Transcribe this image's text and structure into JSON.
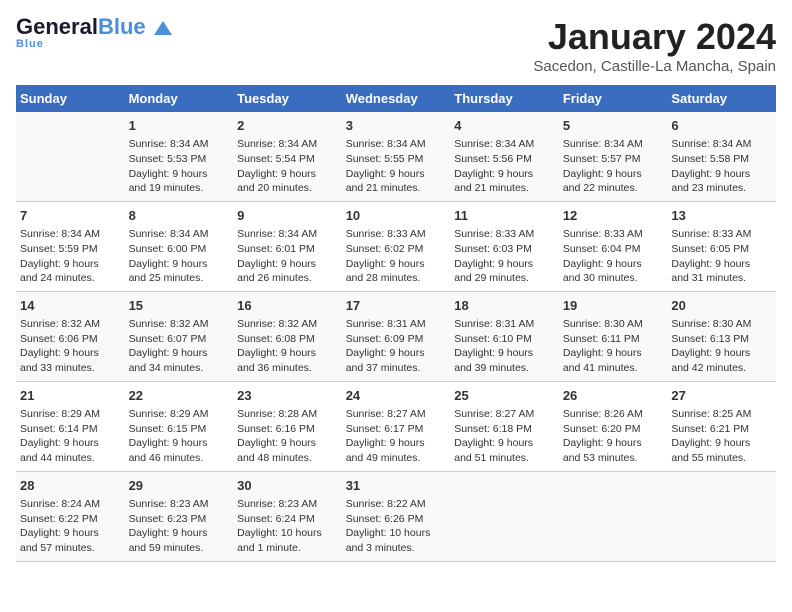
{
  "header": {
    "logo_general": "General",
    "logo_blue": "Blue",
    "logo_tagline": "Blue",
    "title": "January 2024",
    "subtitle": "Sacedon, Castille-La Mancha, Spain"
  },
  "weekdays": [
    "Sunday",
    "Monday",
    "Tuesday",
    "Wednesday",
    "Thursday",
    "Friday",
    "Saturday"
  ],
  "weeks": [
    [
      {
        "day": "",
        "info": ""
      },
      {
        "day": "1",
        "info": "Sunrise: 8:34 AM\nSunset: 5:53 PM\nDaylight: 9 hours\nand 19 minutes."
      },
      {
        "day": "2",
        "info": "Sunrise: 8:34 AM\nSunset: 5:54 PM\nDaylight: 9 hours\nand 20 minutes."
      },
      {
        "day": "3",
        "info": "Sunrise: 8:34 AM\nSunset: 5:55 PM\nDaylight: 9 hours\nand 21 minutes."
      },
      {
        "day": "4",
        "info": "Sunrise: 8:34 AM\nSunset: 5:56 PM\nDaylight: 9 hours\nand 21 minutes."
      },
      {
        "day": "5",
        "info": "Sunrise: 8:34 AM\nSunset: 5:57 PM\nDaylight: 9 hours\nand 22 minutes."
      },
      {
        "day": "6",
        "info": "Sunrise: 8:34 AM\nSunset: 5:58 PM\nDaylight: 9 hours\nand 23 minutes."
      }
    ],
    [
      {
        "day": "7",
        "info": "Sunrise: 8:34 AM\nSunset: 5:59 PM\nDaylight: 9 hours\nand 24 minutes."
      },
      {
        "day": "8",
        "info": "Sunrise: 8:34 AM\nSunset: 6:00 PM\nDaylight: 9 hours\nand 25 minutes."
      },
      {
        "day": "9",
        "info": "Sunrise: 8:34 AM\nSunset: 6:01 PM\nDaylight: 9 hours\nand 26 minutes."
      },
      {
        "day": "10",
        "info": "Sunrise: 8:33 AM\nSunset: 6:02 PM\nDaylight: 9 hours\nand 28 minutes."
      },
      {
        "day": "11",
        "info": "Sunrise: 8:33 AM\nSunset: 6:03 PM\nDaylight: 9 hours\nand 29 minutes."
      },
      {
        "day": "12",
        "info": "Sunrise: 8:33 AM\nSunset: 6:04 PM\nDaylight: 9 hours\nand 30 minutes."
      },
      {
        "day": "13",
        "info": "Sunrise: 8:33 AM\nSunset: 6:05 PM\nDaylight: 9 hours\nand 31 minutes."
      }
    ],
    [
      {
        "day": "14",
        "info": "Sunrise: 8:32 AM\nSunset: 6:06 PM\nDaylight: 9 hours\nand 33 minutes."
      },
      {
        "day": "15",
        "info": "Sunrise: 8:32 AM\nSunset: 6:07 PM\nDaylight: 9 hours\nand 34 minutes."
      },
      {
        "day": "16",
        "info": "Sunrise: 8:32 AM\nSunset: 6:08 PM\nDaylight: 9 hours\nand 36 minutes."
      },
      {
        "day": "17",
        "info": "Sunrise: 8:31 AM\nSunset: 6:09 PM\nDaylight: 9 hours\nand 37 minutes."
      },
      {
        "day": "18",
        "info": "Sunrise: 8:31 AM\nSunset: 6:10 PM\nDaylight: 9 hours\nand 39 minutes."
      },
      {
        "day": "19",
        "info": "Sunrise: 8:30 AM\nSunset: 6:11 PM\nDaylight: 9 hours\nand 41 minutes."
      },
      {
        "day": "20",
        "info": "Sunrise: 8:30 AM\nSunset: 6:13 PM\nDaylight: 9 hours\nand 42 minutes."
      }
    ],
    [
      {
        "day": "21",
        "info": "Sunrise: 8:29 AM\nSunset: 6:14 PM\nDaylight: 9 hours\nand 44 minutes."
      },
      {
        "day": "22",
        "info": "Sunrise: 8:29 AM\nSunset: 6:15 PM\nDaylight: 9 hours\nand 46 minutes."
      },
      {
        "day": "23",
        "info": "Sunrise: 8:28 AM\nSunset: 6:16 PM\nDaylight: 9 hours\nand 48 minutes."
      },
      {
        "day": "24",
        "info": "Sunrise: 8:27 AM\nSunset: 6:17 PM\nDaylight: 9 hours\nand 49 minutes."
      },
      {
        "day": "25",
        "info": "Sunrise: 8:27 AM\nSunset: 6:18 PM\nDaylight: 9 hours\nand 51 minutes."
      },
      {
        "day": "26",
        "info": "Sunrise: 8:26 AM\nSunset: 6:20 PM\nDaylight: 9 hours\nand 53 minutes."
      },
      {
        "day": "27",
        "info": "Sunrise: 8:25 AM\nSunset: 6:21 PM\nDaylight: 9 hours\nand 55 minutes."
      }
    ],
    [
      {
        "day": "28",
        "info": "Sunrise: 8:24 AM\nSunset: 6:22 PM\nDaylight: 9 hours\nand 57 minutes."
      },
      {
        "day": "29",
        "info": "Sunrise: 8:23 AM\nSunset: 6:23 PM\nDaylight: 9 hours\nand 59 minutes."
      },
      {
        "day": "30",
        "info": "Sunrise: 8:23 AM\nSunset: 6:24 PM\nDaylight: 10 hours\nand 1 minute."
      },
      {
        "day": "31",
        "info": "Sunrise: 8:22 AM\nSunset: 6:26 PM\nDaylight: 10 hours\nand 3 minutes."
      },
      {
        "day": "",
        "info": ""
      },
      {
        "day": "",
        "info": ""
      },
      {
        "day": "",
        "info": ""
      }
    ]
  ]
}
